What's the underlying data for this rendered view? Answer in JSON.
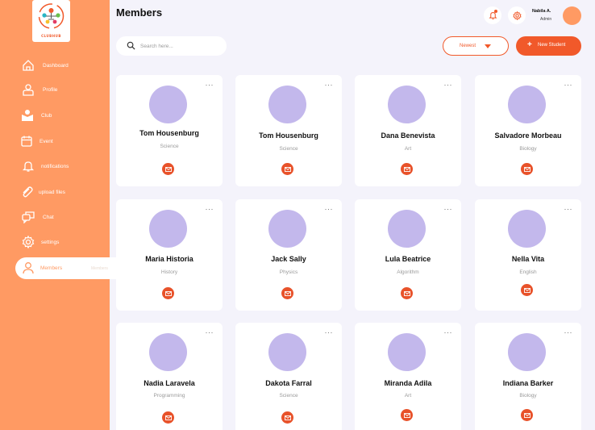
{
  "app": {
    "logo_text": "CLUBHUB"
  },
  "sidebar": {
    "items": [
      {
        "label": "Dashboard",
        "icon": "home-icon"
      },
      {
        "label": "Profile",
        "icon": "profile-icon"
      },
      {
        "label": "Club",
        "icon": "club-icon"
      },
      {
        "label": "Event",
        "icon": "calendar-icon"
      },
      {
        "label": "notifications",
        "icon": "bell-icon"
      },
      {
        "label": "upload files",
        "icon": "paperclip-icon"
      },
      {
        "label": "Chat",
        "icon": "chat-icon"
      },
      {
        "label": "settings",
        "icon": "gear-icon"
      },
      {
        "label": "Members",
        "icon": "user-icon",
        "active": true,
        "trailing": "Members"
      }
    ]
  },
  "header": {
    "title": "Members",
    "user": {
      "name": "Nabila A.",
      "role": "Admin"
    }
  },
  "toolbar": {
    "search_placeholder": "Search here...",
    "sort_label": "Newest",
    "new_button_label": "New Student"
  },
  "members": [
    {
      "name": "Tom Housenburg",
      "subject": "Science"
    },
    {
      "name": "Tom Housenburg",
      "subject": "Science"
    },
    {
      "name": "Dana Benevista",
      "subject": "Art"
    },
    {
      "name": "Salvadore Morbeau",
      "subject": "Biology"
    },
    {
      "name": "Maria Historia",
      "subject": "History"
    },
    {
      "name": "Jack Sally",
      "subject": "Physics"
    },
    {
      "name": "Lula Beatrice",
      "subject": "Algorithm"
    },
    {
      "name": "Nella Vita",
      "subject": "English"
    },
    {
      "name": "Nadia Laravela",
      "subject": "Programming"
    },
    {
      "name": "Dakota Farral",
      "subject": "Science"
    },
    {
      "name": "Miranda Adila",
      "subject": "Art"
    },
    {
      "name": "Indiana Barker",
      "subject": "Biology"
    }
  ],
  "colors": {
    "sidebar": "#ff9a63",
    "accent": "#f1592a",
    "avatar": "#c3b8ec",
    "background": "#f4f3fb"
  }
}
